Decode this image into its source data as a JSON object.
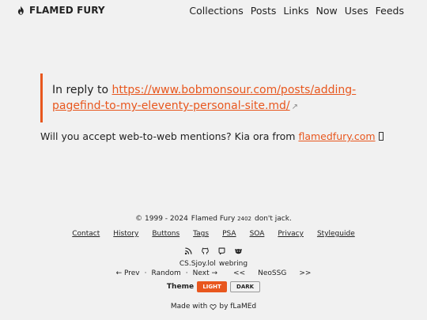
{
  "header": {
    "site_name": "FLAMED FURY",
    "nav": [
      "Collections",
      "Posts",
      "Links",
      "Now",
      "Uses",
      "Feeds"
    ]
  },
  "reply": {
    "prefix": "In reply to",
    "url": "https://www.bobmonsour.com/posts/adding-pagefind-to-my-eleventy-personal-site.md/"
  },
  "mentions": {
    "text": "Will you accept web-to-web mentions? Kia ora from",
    "link": "flamedfury.com"
  },
  "footer": {
    "copyright_prefix": "© 1999 - 2024",
    "site_link": "Flamed Fury",
    "version": "2402",
    "tagline": "don't jack.",
    "links": [
      "Contact",
      "History",
      "Buttons",
      "Tags",
      "PSA",
      "SOA",
      "Privacy",
      "Styleguide"
    ],
    "webring_site": "CS.Sjoy.lol",
    "webring_label": "webring",
    "prev": "← Prev",
    "random": "Random",
    "next": "Next →",
    "ring_prev": "<<",
    "ring_name": "NeoSSG",
    "ring_next": ">>",
    "theme_label": "Theme",
    "theme_light": "LIGHT",
    "theme_dark": "DARK",
    "made_with": "Made with",
    "made_by": "by fLaMEd"
  },
  "colors": {
    "accent": "#e8571e",
    "background": "#f1f1f1",
    "text": "#222222"
  },
  "icons": [
    "flame-icon",
    "rss-icon",
    "github-icon",
    "mastodon-icon",
    "reddit-alien-icon",
    "heart-icon",
    "external-link-icon"
  ]
}
